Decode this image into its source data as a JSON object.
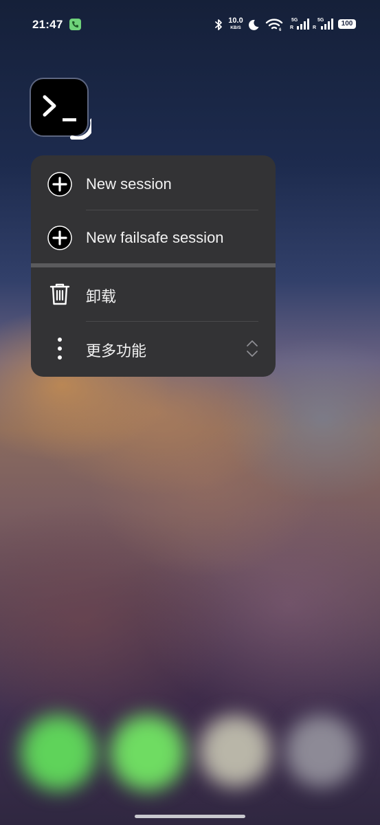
{
  "status_bar": {
    "time": "21:47",
    "net_speed_value": "10.0",
    "net_speed_unit": "KB/S",
    "signal_1_label": "5G",
    "signal_2_label": "5G",
    "roaming_label": "R",
    "battery_level": "100",
    "icons": [
      "call-icon",
      "bluetooth-icon",
      "moon-icon",
      "wifi-icon",
      "signal-icon",
      "signal-icon",
      "battery-icon"
    ]
  },
  "app": {
    "icon": "terminal-icon"
  },
  "context_menu": {
    "items": [
      {
        "label": "New session",
        "icon": "plus-circle-icon"
      },
      {
        "label": "New failsafe session",
        "icon": "plus-circle-icon"
      },
      {
        "label": "卸载",
        "icon": "trash-icon"
      },
      {
        "label": "更多功能",
        "icon": "more-vertical-icon",
        "trailing_icon": "chevron-updown-icon"
      }
    ]
  },
  "dock": {
    "apps": [
      "phone-app",
      "messages-app",
      "camera-app",
      "settings-app"
    ],
    "colors": [
      "#5fd35a",
      "#6fdc62",
      "#b9b6a8",
      "#8d8a96"
    ]
  }
}
